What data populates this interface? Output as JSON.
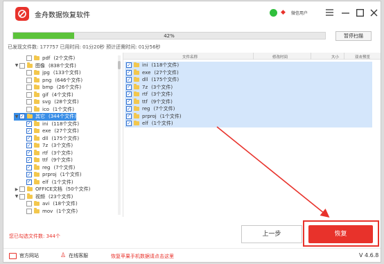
{
  "app": {
    "title": "金舟数据恢复软件",
    "user_label": "微信用户"
  },
  "progress": {
    "percent_text": "42%",
    "fraction": 0.42,
    "pause_label": "暂停扫描"
  },
  "status": {
    "line": "已发现文件数: 177757  已用时间: 01分20秒  预计还需时间: 01分56秒"
  },
  "tree": {
    "rows": [
      {
        "tri": "",
        "checked": false,
        "name": "pdf",
        "count": "(2个文件)",
        "indent": 1,
        "selected": false
      },
      {
        "tri": "▼",
        "checked": false,
        "name": "图像",
        "count": "(838个文件)",
        "indent": 0,
        "selected": false
      },
      {
        "tri": "",
        "checked": false,
        "name": "jpg",
        "count": "(133个文件)",
        "indent": 1,
        "selected": false
      },
      {
        "tri": "",
        "checked": false,
        "name": "png",
        "count": "(646个文件)",
        "indent": 1,
        "selected": false
      },
      {
        "tri": "",
        "checked": false,
        "name": "bmp",
        "count": "(26个文件)",
        "indent": 1,
        "selected": false
      },
      {
        "tri": "",
        "checked": false,
        "name": "gif",
        "count": "(4个文件)",
        "indent": 1,
        "selected": false
      },
      {
        "tri": "",
        "checked": false,
        "name": "svg",
        "count": "(28个文件)",
        "indent": 1,
        "selected": false
      },
      {
        "tri": "",
        "checked": false,
        "name": "ico",
        "count": "(1个文件)",
        "indent": 1,
        "selected": false
      },
      {
        "tri": "▼",
        "checked": true,
        "name": "其它",
        "count": "(344个文件)",
        "indent": 0,
        "selected": true
      },
      {
        "tri": "",
        "checked": true,
        "name": "ini",
        "count": "(118个文件)",
        "indent": 1,
        "selected": false
      },
      {
        "tri": "",
        "checked": true,
        "name": "exe",
        "count": "(27个文件)",
        "indent": 1,
        "selected": false
      },
      {
        "tri": "",
        "checked": true,
        "name": "dll",
        "count": "(175个文件)",
        "indent": 1,
        "selected": false
      },
      {
        "tri": "",
        "checked": true,
        "name": "7z",
        "count": "(3个文件)",
        "indent": 1,
        "selected": false
      },
      {
        "tri": "",
        "checked": true,
        "name": "rtf",
        "count": "(3个文件)",
        "indent": 1,
        "selected": false
      },
      {
        "tri": "",
        "checked": true,
        "name": "ttf",
        "count": "(9个文件)",
        "indent": 1,
        "selected": false
      },
      {
        "tri": "",
        "checked": true,
        "name": "reg",
        "count": "(7个文件)",
        "indent": 1,
        "selected": false
      },
      {
        "tri": "",
        "checked": true,
        "name": "prproj",
        "count": "(1个文件)",
        "indent": 1,
        "selected": false
      },
      {
        "tri": "",
        "checked": true,
        "name": "elf",
        "count": "(1个文件)",
        "indent": 1,
        "selected": false
      },
      {
        "tri": "▶",
        "checked": false,
        "name": "OFFICE文档",
        "count": "(50个文件)",
        "indent": 0,
        "selected": false
      },
      {
        "tri": "▼",
        "checked": false,
        "name": "视频",
        "count": "(23个文件)",
        "indent": 0,
        "selected": false
      },
      {
        "tri": "",
        "checked": false,
        "name": "avi",
        "count": "(18个文件)",
        "indent": 1,
        "selected": false
      },
      {
        "tri": "",
        "checked": false,
        "name": "mov",
        "count": "(1个文件)",
        "indent": 1,
        "selected": false
      }
    ]
  },
  "filelist": {
    "headers": [
      "文件名称",
      "修改时间",
      "大小",
      "双击预览"
    ],
    "rows": [
      {
        "name": "ini",
        "count": "(118个文件)"
      },
      {
        "name": "exe",
        "count": "(27个文件)"
      },
      {
        "name": "dll",
        "count": "(175个文件)"
      },
      {
        "name": "7z",
        "count": "(3个文件)"
      },
      {
        "name": "rtf",
        "count": "(3个文件)"
      },
      {
        "name": "ttf",
        "count": "(9个文件)"
      },
      {
        "name": "reg",
        "count": "(7个文件)"
      },
      {
        "name": "prproj",
        "count": "(1个文件)"
      },
      {
        "name": "elf",
        "count": "(1个文件)"
      }
    ]
  },
  "bottom": {
    "selected_info": "您已勾选文件数: 344个",
    "prev_label": "上一步",
    "recover_label": "恢复"
  },
  "footer": {
    "website": "官方网站",
    "support": "在线客服",
    "mobile_link": "恢复苹果手机数据请点击这里",
    "version": "V 4.6.8"
  },
  "colors": {
    "accent": "#e8322b",
    "progress": "#5cc33a",
    "selection": "#3a8ee6",
    "row_highlight": "#d4e6fb"
  }
}
